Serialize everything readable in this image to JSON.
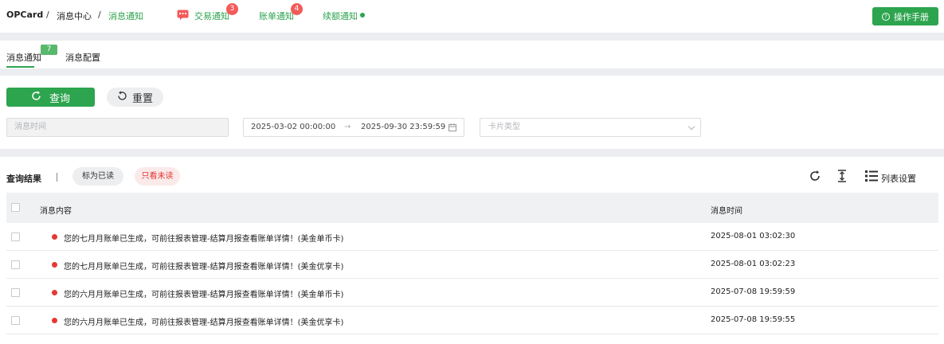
{
  "breadcrumb": {
    "root": "OPCard",
    "sep": "/",
    "parent": "消息中心",
    "current": "消息通知"
  },
  "notify_links": [
    {
      "label": "交易通知",
      "count": "3"
    },
    {
      "label": "账单通知",
      "count": "4"
    },
    {
      "label": "续额通知"
    }
  ],
  "manual_button": "操作手册",
  "tabs": [
    {
      "label": "消息通知",
      "badge": "7",
      "active": true
    },
    {
      "label": "消息配置"
    }
  ],
  "query": {
    "query_button": "查询",
    "reset_button": "重置",
    "time_placeholder": "消息时间",
    "range_start": "2025-03-02 00:00:00",
    "range_arrow": "→",
    "range_end": "2025-09-30 23:59:59",
    "card_type_placeholder": "卡片类型"
  },
  "results": {
    "title": "查询结果",
    "mark_read": "标为已读",
    "only_unread": "只看未读",
    "list_setting": "列表设置",
    "columns": {
      "content": "消息内容",
      "time": "消息时间"
    },
    "rows": [
      {
        "content": "您的七月月账单已生成，可前往报表管理-结算月报查看账单详情！(美金单币卡)",
        "time": "2025-08-01 03:02:30"
      },
      {
        "content": "您的七月月账单已生成，可前往报表管理-结算月报查看账单详情！(美金优享卡)",
        "time": "2025-08-01 03:02:23"
      },
      {
        "content": "您的六月月账单已生成，可前往报表管理-结算月报查看账单详情！(美金单币卡)",
        "time": "2025-07-08 19:59:59"
      },
      {
        "content": "您的六月月账单已生成，可前往报表管理-结算月报查看账单详情！(美金优享卡)",
        "time": "2025-07-08 19:59:55"
      }
    ]
  },
  "colors": {
    "accent": "#2da44e",
    "danger": "#e53935",
    "badge": "#f45a5a"
  }
}
